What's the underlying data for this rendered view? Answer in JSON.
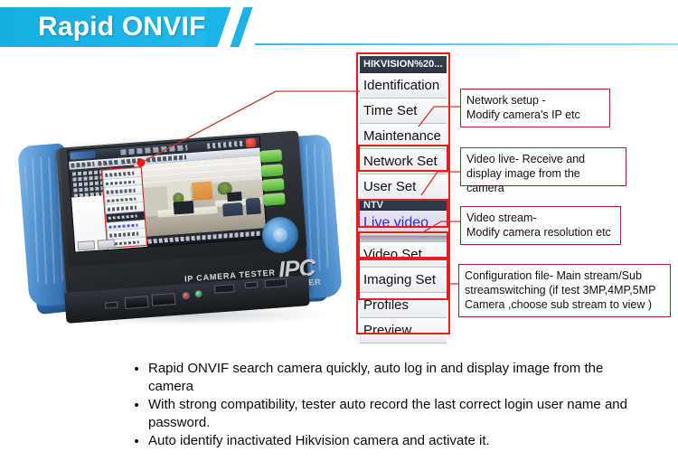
{
  "banner": {
    "title": "Rapid ONVIF",
    "accent_color": "#1cb4e6"
  },
  "menu": {
    "header": "HIKVISION%20...",
    "items": [
      {
        "label": "Identification"
      },
      {
        "label": "Time Set"
      },
      {
        "label": "Maintenance"
      },
      {
        "label": "Network Set"
      },
      {
        "label": "User Set"
      },
      {
        "label": "NTV"
      },
      {
        "label": "Live video"
      },
      {
        "label": "Video Set"
      },
      {
        "label": "Imaging Set"
      },
      {
        "label": "Profiles"
      },
      {
        "label": "Preview"
      }
    ],
    "highlight_color": "#e02020",
    "live_video_color": "#2b2bd0"
  },
  "callouts": [
    {
      "line1": "Network setup -",
      "line2": "Modify camera's  IP etc"
    },
    {
      "line1": "Video live- Receive and",
      "line2": "display image from the camera"
    },
    {
      "line1": "Video stream-",
      "line2": "Modify camera resolution etc"
    },
    {
      "line1": "Configuration file- Main stream/Sub",
      "line2": "streamswitching (if test 3MP,4MP,5MP",
      "line3": "Camera  ,choose sub stream to view )"
    }
  ],
  "device": {
    "brand": "IPC",
    "sub_brand": "TESTER",
    "face_label": "IP  CAMERA TESTER"
  },
  "features": [
    "Rapid ONVIF search camera quickly, auto log in and display image from the camera",
    "With strong compatibility, tester auto record the last correct login user name and password.",
    "Auto identify inactivated Hikvision camera and activate it."
  ]
}
